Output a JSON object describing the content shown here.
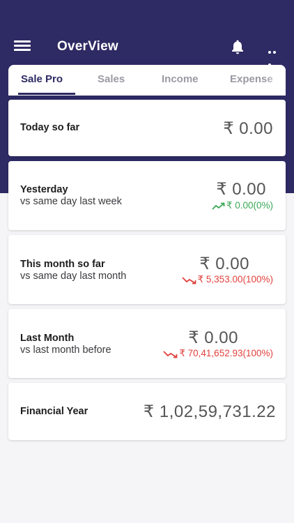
{
  "header": {
    "title": "OverView"
  },
  "tabs": [
    {
      "label": "Sale Pro"
    },
    {
      "label": "Sales"
    },
    {
      "label": "Income"
    },
    {
      "label": "Expense"
    }
  ],
  "cards": {
    "today": {
      "label": "Today so far",
      "amount": "₹ 0.00"
    },
    "yesterday": {
      "label": "Yesterday",
      "sub": "vs same day last week",
      "amount": "₹ 0.00",
      "change": "₹ 0.00(0%)",
      "trend": "up"
    },
    "this_month": {
      "label": "This month so far",
      "sub": "vs same day last month",
      "amount": "₹ 0.00",
      "change": "₹ 5,353.00(100%)",
      "trend": "down"
    },
    "last_month": {
      "label": "Last Month",
      "sub": "vs last month before",
      "amount": "₹ 0.00",
      "change": "₹ 70,41,652.93(100%)",
      "trend": "down"
    },
    "financial_year": {
      "label": "Financial Year",
      "amount": "₹ 1,02,59,731.22"
    }
  },
  "colors": {
    "header_bg": "#2e2a63",
    "positive": "#3aa857",
    "negative": "#e0413c"
  },
  "icons": [
    "hamburger-menu-icon",
    "bell-icon",
    "more-dots-icon",
    "trend-up-icon",
    "trend-down-icon"
  ]
}
